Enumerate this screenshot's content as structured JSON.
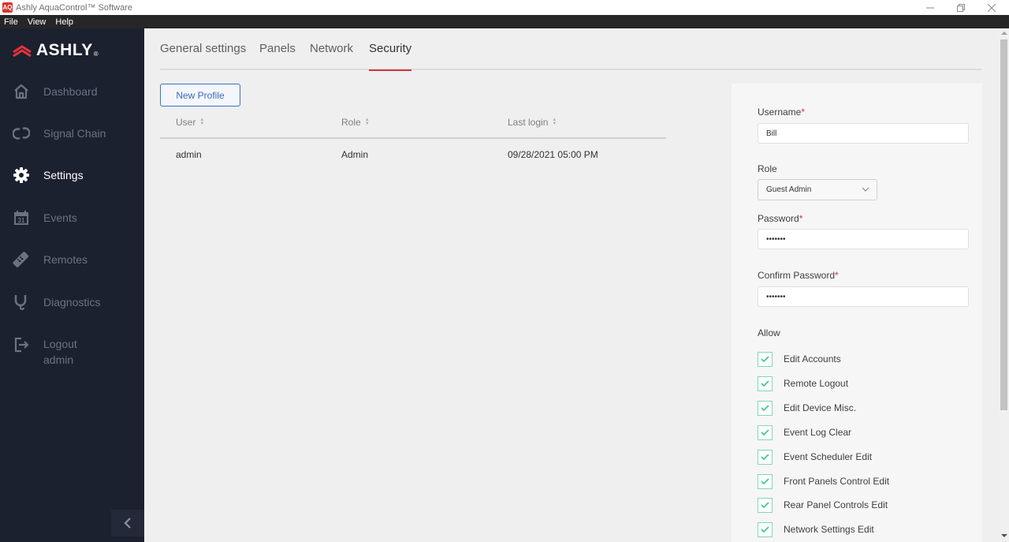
{
  "window": {
    "title": "Ashly AquaControl™ Software",
    "app_icon": "ashly-app-icon",
    "controls": {
      "minimize": "—",
      "maximize": "❐",
      "close": "✕"
    }
  },
  "menubar": {
    "items": [
      "File",
      "View",
      "Help"
    ]
  },
  "sidebar": {
    "logo_text": "ASHLY",
    "logo_reg": "®",
    "items": [
      {
        "label": "Dashboard",
        "icon": "home-icon",
        "active": false
      },
      {
        "label": "Signal Chain",
        "icon": "link-icon",
        "active": false
      },
      {
        "label": "Settings",
        "icon": "gear-icon",
        "active": true
      },
      {
        "label": "Events",
        "icon": "calendar-icon",
        "icon_text": "31",
        "active": false
      },
      {
        "label": "Remotes",
        "icon": "remote-icon",
        "active": false
      },
      {
        "label": "Diagnostics",
        "icon": "stethoscope-icon",
        "active": false
      },
      {
        "label": "Logout",
        "sublabel": "admin",
        "icon": "logout-icon",
        "active": false
      }
    ],
    "collapse_icon": "chevron-left-icon"
  },
  "tabs": [
    {
      "label": "General settings",
      "active": false
    },
    {
      "label": "Panels",
      "active": false
    },
    {
      "label": "Network",
      "active": false
    },
    {
      "label": "Security",
      "active": true
    }
  ],
  "new_profile_label": "New Profile",
  "table": {
    "columns": [
      "User",
      "Role",
      "Last login"
    ],
    "rows": [
      {
        "user": "admin",
        "role": "Admin",
        "last_login": "09/28/2021 05:00 PM"
      }
    ]
  },
  "form": {
    "username_label": "Username",
    "username_value": "Bill",
    "role_label": "Role",
    "role_value": "Guest Admin",
    "password_label": "Password",
    "password_value": "•••••••",
    "confirm_label": "Confirm Password",
    "confirm_value": "•••••••",
    "required_mark": "*",
    "allow_label": "Allow",
    "permissions": [
      {
        "label": "Edit Accounts",
        "checked": true
      },
      {
        "label": "Remote Logout",
        "checked": true
      },
      {
        "label": "Edit Device Misc.",
        "checked": true
      },
      {
        "label": "Event Log Clear",
        "checked": true
      },
      {
        "label": "Event Scheduler Edit",
        "checked": true
      },
      {
        "label": "Front Panels Control Edit",
        "checked": true
      },
      {
        "label": "Rear Panel Controls Edit",
        "checked": true
      },
      {
        "label": "Network Settings Edit",
        "checked": true
      }
    ]
  },
  "colors": {
    "accent_red": "#d2343d",
    "link_blue": "#3a6bc0",
    "check_green": "#3cc48e",
    "sidebar_bg": "#1c2130"
  }
}
